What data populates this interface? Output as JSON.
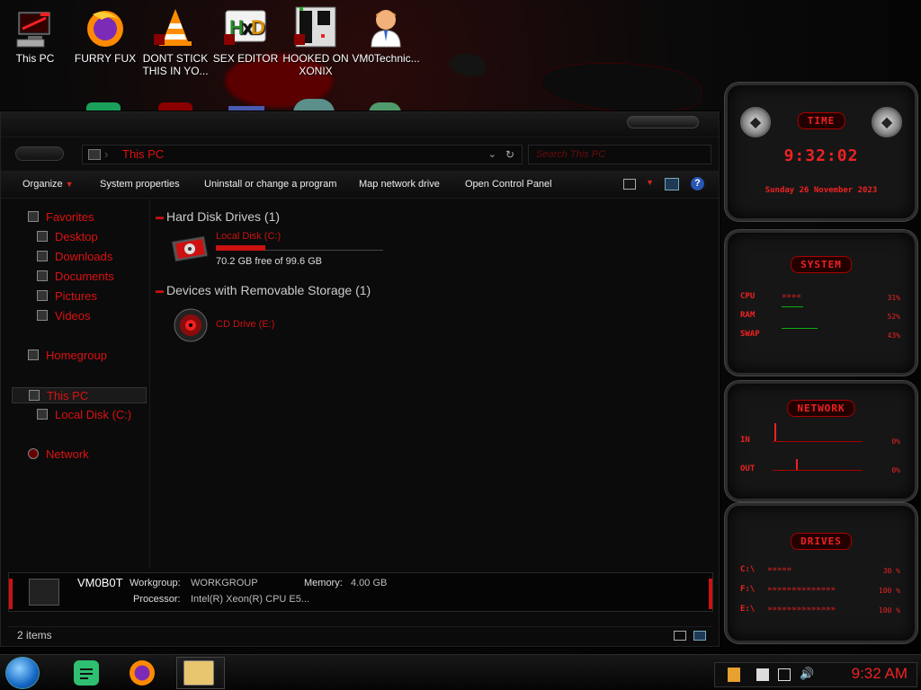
{
  "desktop_icons": [
    {
      "label": "This PC",
      "icon": "this-pc-icon"
    },
    {
      "label": "FURRY FUX",
      "icon": "firefox-icon"
    },
    {
      "label": "DONT STICK THIS IN YO...",
      "icon": "vlc-cone-icon"
    },
    {
      "label": "SEX EDITOR",
      "icon": "hxd-editor-icon"
    },
    {
      "label": "HOOKED ON XONIX",
      "icon": "xonix-game-icon"
    },
    {
      "label": "VM0Technic...",
      "icon": "doctor-avatar-icon"
    }
  ],
  "explorer": {
    "address": "This PC",
    "search_placeholder": "Search This PC",
    "toolbar": {
      "organize": "Organize",
      "system_properties": "System properties",
      "uninstall": "Uninstall or change a program",
      "map_drive": "Map network drive",
      "control_panel": "Open Control Panel"
    },
    "nav": {
      "favorites": "Favorites",
      "desktop": "Desktop",
      "downloads": "Downloads",
      "documents": "Documents",
      "pictures": "Pictures",
      "videos": "Videos",
      "homegroup": "Homegroup",
      "this_pc": "This PC",
      "local_disk": "Local Disk (C:)",
      "network": "Network"
    },
    "groups": {
      "hdd_header": "Hard Disk Drives (1)",
      "removable_header": "Devices with Removable Storage (1)"
    },
    "drives": {
      "local_name": "Local Disk (C:)",
      "local_free": "70.2 GB free of 99.6 GB",
      "local_used_fraction": 0.295,
      "cd_name": "CD Drive (E:)"
    },
    "details": {
      "computer_name": "VM0B0T",
      "workgroup_label": "Workgroup:",
      "workgroup_value": "WORKGROUP",
      "memory_label": "Memory:",
      "memory_value": "4.00 GB",
      "processor_label": "Processor:",
      "processor_value": "Intel(R) Xeon(R) CPU E5..."
    },
    "status": "2 items"
  },
  "gadgets": {
    "time": {
      "title": "TIME",
      "clock": "9:32:02",
      "date": "Sunday 26 November 2023"
    },
    "system": {
      "title": "SYSTEM",
      "rows": [
        {
          "label": "CPU",
          "value": "31%"
        },
        {
          "label": "RAM",
          "value": "52%"
        },
        {
          "label": "SWAP",
          "value": "43%"
        }
      ]
    },
    "network": {
      "title": "NETWORK",
      "in_label": "IN",
      "in_value": "0%",
      "out_label": "OUT",
      "out_value": "0%"
    },
    "drives": {
      "title": "DRIVES",
      "rows": [
        {
          "label": "C:\\",
          "value": "30 %"
        },
        {
          "label": "F:\\",
          "value": "100 %"
        },
        {
          "label": "E:\\",
          "value": "100 %"
        }
      ]
    }
  },
  "taskbar": {
    "clock": "9:32 AM"
  },
  "colors": {
    "accent": "#dd1111",
    "bg": "#0b0b0b"
  }
}
